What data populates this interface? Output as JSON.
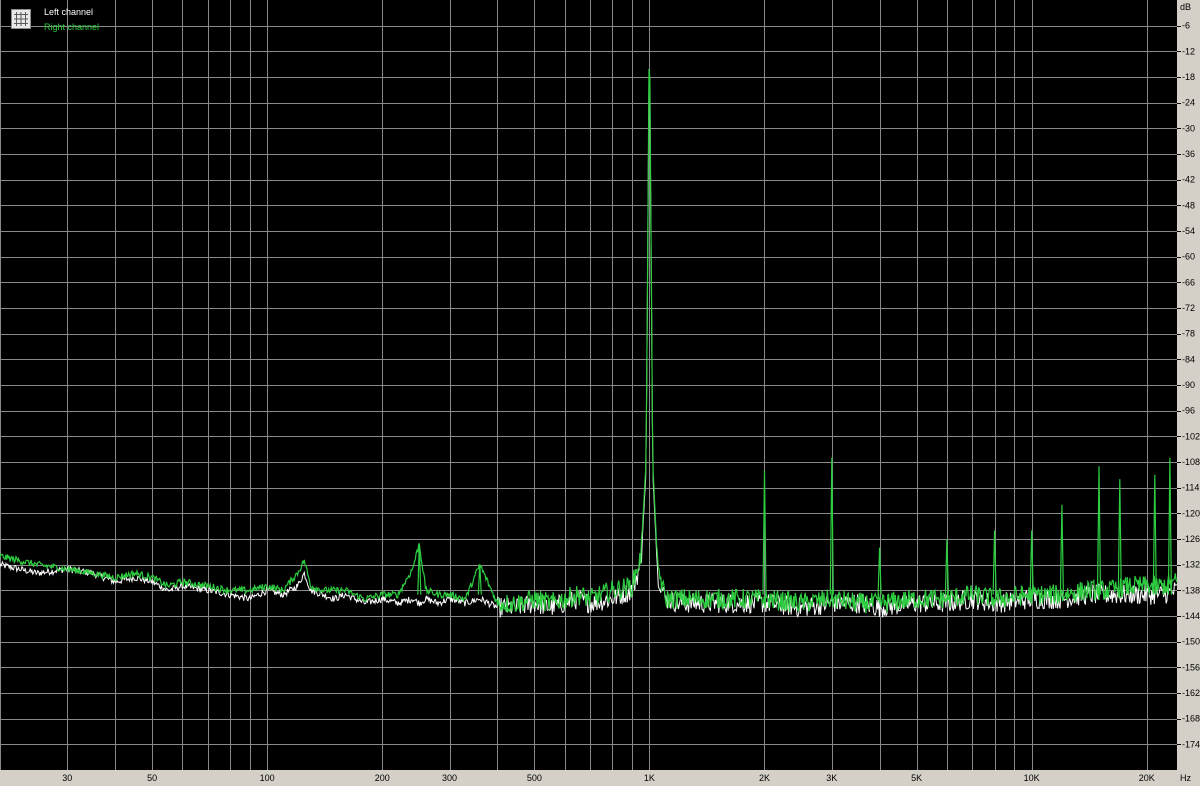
{
  "chart_data": {
    "type": "line",
    "x_scale": "log",
    "y_unit": "dB",
    "x_unit": "Hz",
    "xlim": [
      20,
      24000
    ],
    "ylim": [
      -180,
      0
    ],
    "grid": true,
    "legend_position": "top-left",
    "background": "#000000",
    "y_ticks": [
      "-6",
      "-12",
      "-18",
      "-24",
      "-30",
      "-36",
      "-42",
      "-48",
      "-54",
      "-60",
      "-66",
      "-72",
      "-78",
      "-84",
      "-90",
      "-96",
      "-102",
      "-108",
      "-114",
      "-120",
      "-126",
      "-132",
      "-138",
      "-144",
      "-150",
      "-156",
      "-162",
      "-168",
      "-174"
    ],
    "x_ticks": [
      {
        "label": "30",
        "value": 30
      },
      {
        "label": "50",
        "value": 50
      },
      {
        "label": "100",
        "value": 100
      },
      {
        "label": "200",
        "value": 200
      },
      {
        "label": "300",
        "value": 300
      },
      {
        "label": "500",
        "value": 500
      },
      {
        "label": "1K",
        "value": 1000
      },
      {
        "label": "2K",
        "value": 2000
      },
      {
        "label": "3K",
        "value": 3000
      },
      {
        "label": "5K",
        "value": 5000
      },
      {
        "label": "10K",
        "value": 10000
      },
      {
        "label": "20K",
        "value": 20000
      }
    ],
    "series": [
      {
        "name": "Left channel",
        "color": "#ffffff",
        "x": [
          20,
          25,
          30,
          35,
          40,
          45,
          50,
          55,
          60,
          70,
          80,
          90,
          100,
          110,
          120,
          125,
          130,
          140,
          150,
          160,
          180,
          200,
          220,
          240,
          250,
          260,
          280,
          300,
          330,
          360,
          400,
          450,
          500,
          550,
          600,
          650,
          700,
          800,
          900,
          950,
          980,
          1000,
          1020,
          1050,
          1100,
          1200,
          1500,
          2000,
          2500,
          3000,
          3500,
          4000,
          5000,
          6000,
          7000,
          8000,
          10000,
          12000,
          14000,
          16000,
          18000,
          20000,
          22000,
          24000
        ],
        "y": [
          -132,
          -134,
          -133,
          -134,
          -136,
          -135,
          -136,
          -138,
          -137,
          -138,
          -139,
          -140,
          -138,
          -139,
          -137,
          -134,
          -138,
          -139,
          -140,
          -139,
          -141,
          -140,
          -141,
          -140,
          -141,
          -140,
          -141,
          -140,
          -141,
          -140,
          -142,
          -142,
          -141,
          -142,
          -141,
          -140,
          -141,
          -140,
          -138,
          -132,
          -110,
          -6,
          -110,
          -134,
          -140,
          -141,
          -141,
          -141,
          -142,
          -141,
          -141,
          -142,
          -141,
          -141,
          -140,
          -141,
          -140,
          -140,
          -139,
          -139,
          -139,
          -139,
          -139,
          -138
        ]
      },
      {
        "name": "Right channel",
        "color": "#2ecc40",
        "x": [
          20,
          25,
          30,
          35,
          40,
          45,
          50,
          55,
          60,
          70,
          80,
          90,
          100,
          110,
          120,
          125,
          130,
          140,
          150,
          160,
          180,
          200,
          220,
          240,
          250,
          260,
          280,
          300,
          330,
          360,
          400,
          450,
          500,
          550,
          600,
          650,
          700,
          800,
          900,
          950,
          980,
          1000,
          1020,
          1050,
          1100,
          1200,
          1500,
          2000,
          2500,
          3000,
          3500,
          4000,
          5000,
          6000,
          7000,
          8000,
          10000,
          12000,
          14000,
          16000,
          18000,
          20000,
          22000,
          24000
        ],
        "y": [
          -130,
          -132,
          -133,
          -134,
          -135,
          -134,
          -135,
          -137,
          -136,
          -137,
          -138,
          -138,
          -137,
          -138,
          -134,
          -131,
          -137,
          -138,
          -138,
          -138,
          -140,
          -139,
          -139,
          -133,
          -127,
          -138,
          -139,
          -139,
          -140,
          -132,
          -141,
          -141,
          -140,
          -141,
          -140,
          -139,
          -140,
          -138,
          -137,
          -130,
          -108,
          -4,
          -108,
          -132,
          -140,
          -140,
          -140,
          -140,
          -141,
          -140,
          -141,
          -141,
          -140,
          -140,
          -139,
          -140,
          -139,
          -139,
          -138,
          -138,
          -137,
          -137,
          -137,
          -136
        ]
      }
    ],
    "spikes": [
      {
        "freq": 250,
        "db": -127,
        "series": "Right channel"
      },
      {
        "freq": 360,
        "db": -132,
        "series": "Right channel"
      },
      {
        "freq": 2000,
        "db": -110,
        "series": "Right channel"
      },
      {
        "freq": 3000,
        "db": -107,
        "series": "Right channel"
      },
      {
        "freq": 4000,
        "db": -128,
        "series": "Right channel"
      },
      {
        "freq": 6000,
        "db": -126,
        "series": "Right channel"
      },
      {
        "freq": 8000,
        "db": -124,
        "series": "Right channel"
      },
      {
        "freq": 10000,
        "db": -124,
        "series": "Right channel"
      },
      {
        "freq": 12000,
        "db": -118,
        "series": "Right channel"
      },
      {
        "freq": 15000,
        "db": -109,
        "series": "Right channel"
      },
      {
        "freq": 17000,
        "db": -112,
        "series": "Right channel"
      },
      {
        "freq": 21000,
        "db": -111,
        "series": "Right channel"
      },
      {
        "freq": 23000,
        "db": -107,
        "series": "Right channel"
      }
    ]
  },
  "legend": {
    "left_label": "Left channel",
    "right_label": "Right channel"
  },
  "axis": {
    "y_unit_label": "dB",
    "x_unit_label": "Hz"
  }
}
